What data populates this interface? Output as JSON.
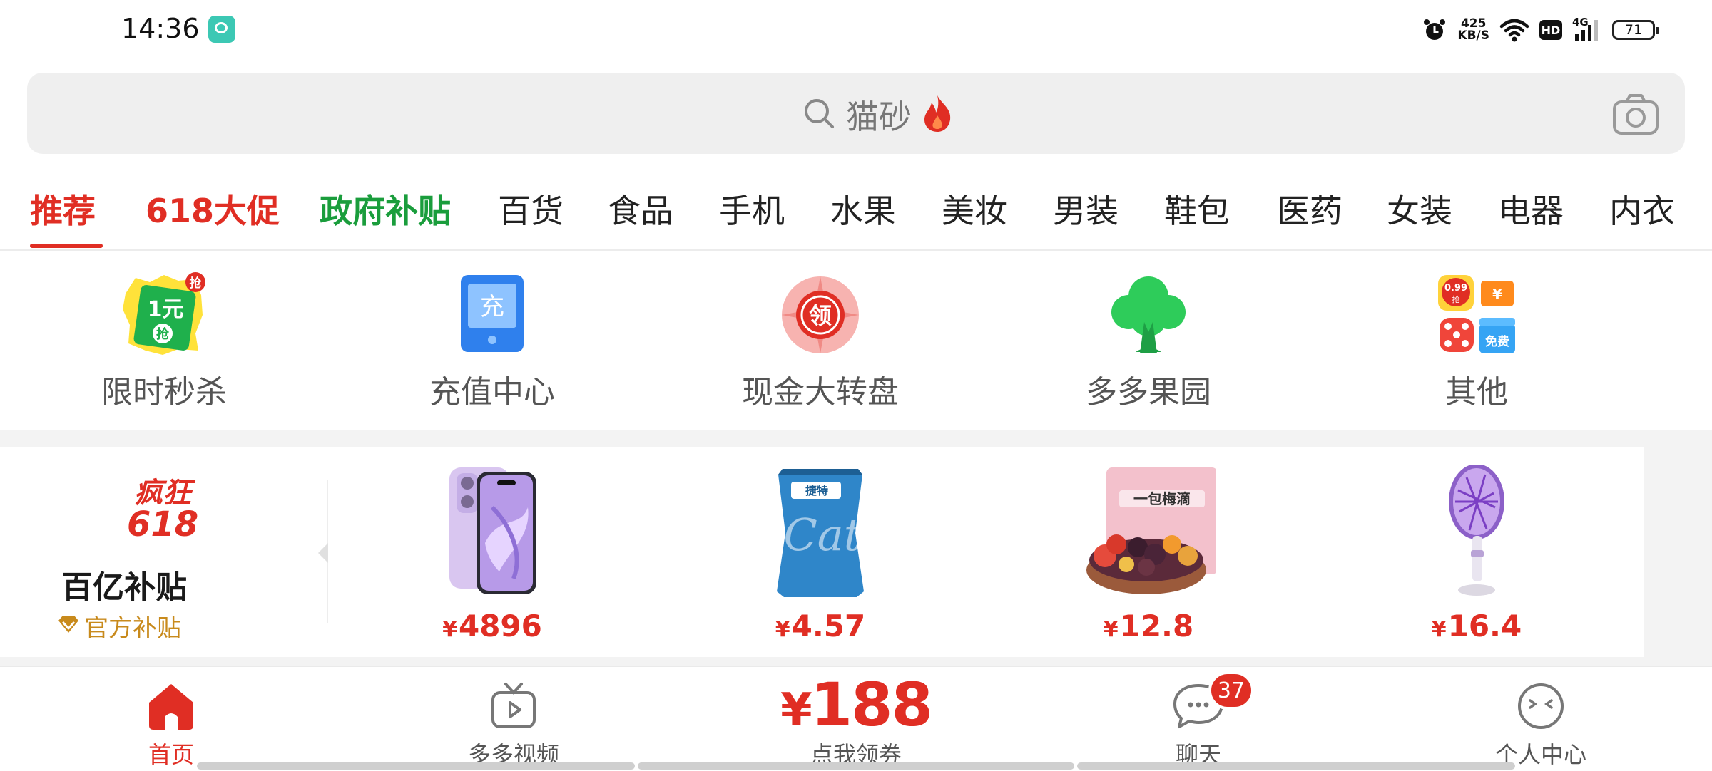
{
  "status_bar": {
    "time": "14:36",
    "network_speed_value": "425",
    "network_speed_unit": "KB/S",
    "hd_label": "HD",
    "signal_label": "4G",
    "battery": "71"
  },
  "search": {
    "placeholder": "猫砂",
    "icons": [
      "search-icon",
      "fire-icon",
      "camera-icon"
    ]
  },
  "tabs": [
    {
      "label": "推荐",
      "active": true
    },
    {
      "label": "618大促"
    },
    {
      "label": "政府补贴"
    },
    {
      "label": "百货"
    },
    {
      "label": "食品"
    },
    {
      "label": "手机"
    },
    {
      "label": "水果"
    },
    {
      "label": "美妆"
    },
    {
      "label": "男装"
    },
    {
      "label": "鞋包"
    },
    {
      "label": "医药"
    },
    {
      "label": "女装"
    },
    {
      "label": "电器"
    },
    {
      "label": "内衣"
    }
  ],
  "shortcuts": [
    {
      "label": "限时秒杀",
      "icon": "flash-sale-icon",
      "icon_text": "1元",
      "icon_sub": "抢",
      "corner": "抢"
    },
    {
      "label": "充值中心",
      "icon": "recharge-icon",
      "icon_text": "充"
    },
    {
      "label": "现金大转盘",
      "icon": "cash-wheel-icon",
      "icon_text": "领"
    },
    {
      "label": "多多果园",
      "icon": "orchard-tree-icon"
    },
    {
      "label": "其他",
      "icon": "other-apps-icon",
      "mini_labels": [
        "0.99",
        "抢",
        "¥",
        "免费"
      ]
    }
  ],
  "subsidy": {
    "logo_line1": "疯狂",
    "logo_line2": "618",
    "title": "百亿补贴",
    "official_label": "官方补贴",
    "products": [
      {
        "name": "phone",
        "yen": "¥",
        "price": "4896"
      },
      {
        "name": "cat-litter",
        "yen": "¥",
        "price": "4.57",
        "package_text": "Cat",
        "brand": "捷特"
      },
      {
        "name": "dried-plum-snack",
        "yen": "¥",
        "price": "12.8",
        "package_text": "一包梅滴"
      },
      {
        "name": "mosquito-swatter",
        "yen": "¥",
        "price": "16.4"
      }
    ]
  },
  "bottom_nav": [
    {
      "label": "首页",
      "icon": "home-icon",
      "active": true
    },
    {
      "label": "多多视频",
      "icon": "tv-play-icon"
    },
    {
      "label": "点我领券",
      "coupon_yen": "¥",
      "coupon_value": "188"
    },
    {
      "label": "聊天",
      "icon": "chat-bubble-icon",
      "badge": "37"
    },
    {
      "label": "个人中心",
      "icon": "profile-face-icon"
    }
  ],
  "colors": {
    "brand_red": "#e02e24",
    "gov_green": "#1a9d3c",
    "official_gold": "#c88a1c",
    "search_bg": "#efefef"
  }
}
